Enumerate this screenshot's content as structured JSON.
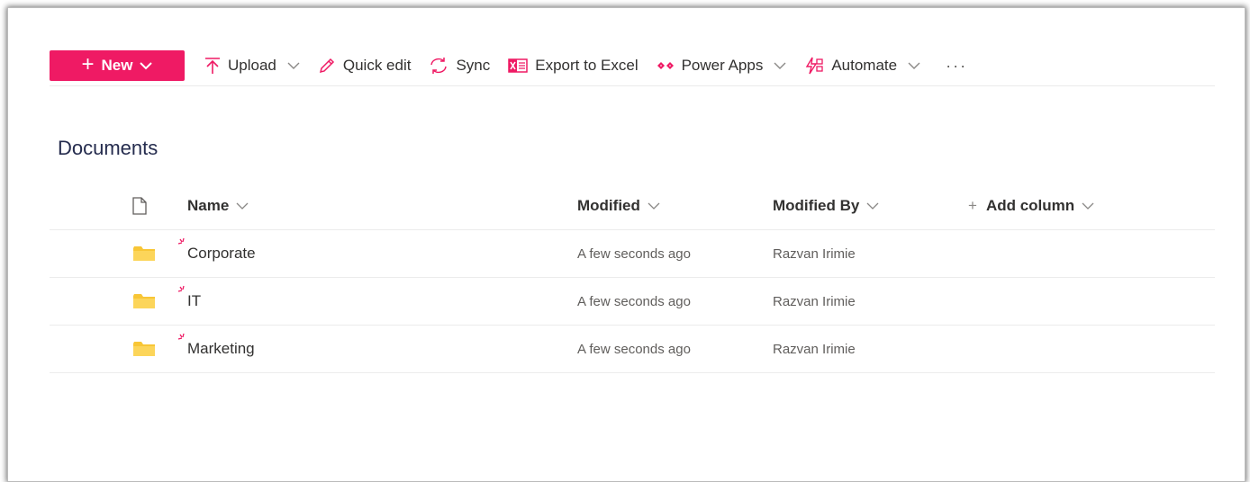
{
  "colors": {
    "accent": "#ef1a64",
    "folder": "#f8c636",
    "text": "#323130",
    "muted": "#605e5c",
    "title": "#252c4e"
  },
  "toolbar": {
    "new_label": "New",
    "upload_label": "Upload",
    "quick_edit_label": "Quick edit",
    "sync_label": "Sync",
    "export_label": "Export to Excel",
    "power_apps_label": "Power Apps",
    "automate_label": "Automate",
    "more_label": "···"
  },
  "library": {
    "title": "Documents"
  },
  "table": {
    "columns": {
      "name": "Name",
      "modified": "Modified",
      "modified_by": "Modified By",
      "add_column": "Add column",
      "add_plus": "+"
    },
    "rows": [
      {
        "name": "Corporate",
        "modified": "A few seconds ago",
        "modified_by": "Razvan Irimie",
        "icon": "folder-icon"
      },
      {
        "name": "IT",
        "modified": "A few seconds ago",
        "modified_by": "Razvan Irimie",
        "icon": "folder-icon"
      },
      {
        "name": "Marketing",
        "modified": "A few seconds ago",
        "modified_by": "Razvan Irimie",
        "icon": "folder-icon"
      }
    ]
  }
}
